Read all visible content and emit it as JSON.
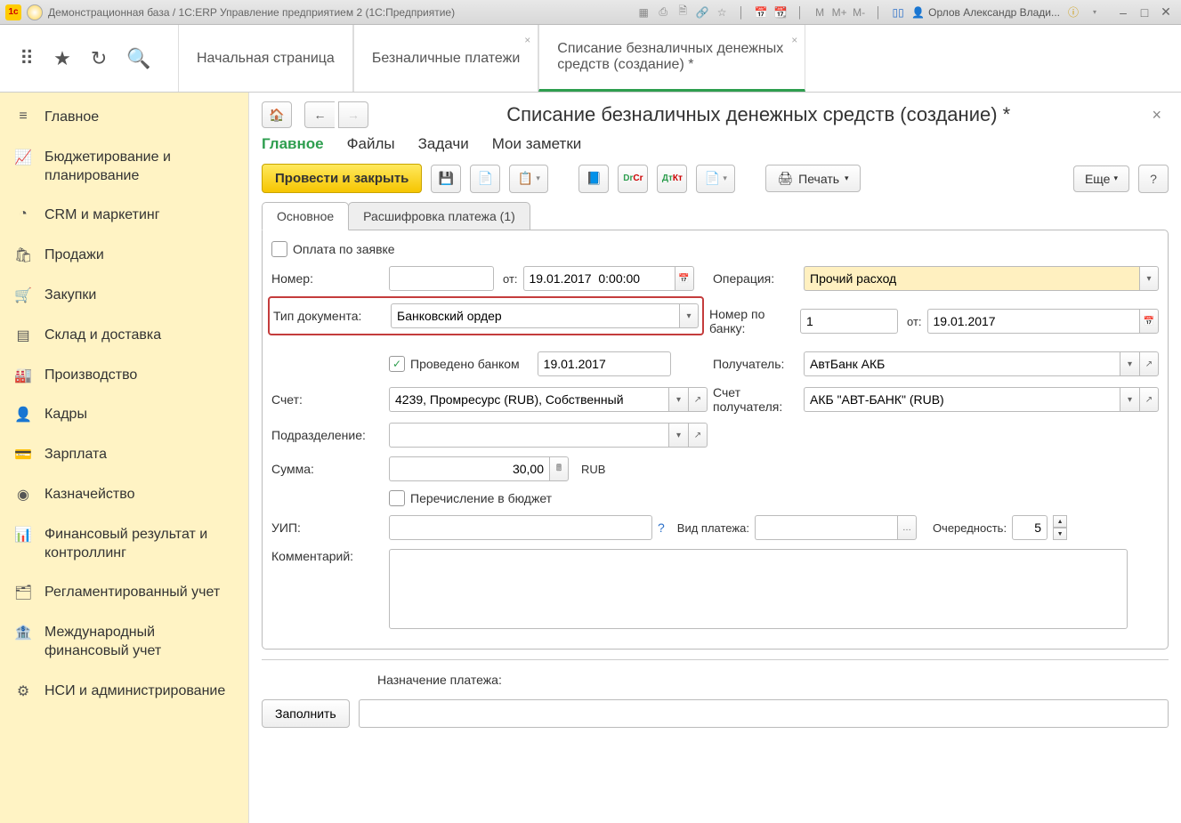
{
  "titlebar": {
    "title": "Демонстрационная база / 1С:ERP Управление предприятием 2  (1С:Предприятие)",
    "user": "Орлов Александр Влади..."
  },
  "top_tabs": {
    "tab0": "Начальная страница",
    "tab1": "Безналичные платежи",
    "tab2": "Списание безналичных денежных средств (создание) *"
  },
  "sidebar": [
    {
      "icon": "≡",
      "label": "Главное"
    },
    {
      "icon": "📈",
      "label": "Бюджетирование и планирование"
    },
    {
      "icon": "◔",
      "label": "CRM и маркетинг"
    },
    {
      "icon": "🛍",
      "label": "Продажи"
    },
    {
      "icon": "🛒",
      "label": "Закупки"
    },
    {
      "icon": "▤",
      "label": "Склад и доставка"
    },
    {
      "icon": "🏭",
      "label": "Производство"
    },
    {
      "icon": "👤",
      "label": "Кадры"
    },
    {
      "icon": "💳",
      "label": "Зарплата"
    },
    {
      "icon": "◉",
      "label": "Казначейство"
    },
    {
      "icon": "📊",
      "label": "Финансовый результат и контроллинг"
    },
    {
      "icon": "🗂",
      "label": "Регламентированный учет"
    },
    {
      "icon": "🏦",
      "label": "Международный финансовый учет"
    },
    {
      "icon": "⚙",
      "label": "НСИ и администрирование"
    }
  ],
  "page": {
    "title": "Списание безналичных денежных средств (создание) *",
    "section_tabs": {
      "main": "Главное",
      "files": "Файлы",
      "tasks": "Задачи",
      "notes": "Мои заметки"
    },
    "btn_post_close": "Провести и закрыть",
    "btn_print": "Печать",
    "btn_more": "Еще",
    "content_tabs": {
      "tab0": "Основное",
      "tab1": "Расшифровка платежа (1)"
    }
  },
  "form": {
    "pay_by_request_lbl": "Оплата по заявке",
    "number_lbl": "Номер:",
    "number_val": "",
    "from_lbl": "от:",
    "from_val": "19.01.2017  0:00:00",
    "operation_lbl": "Операция:",
    "operation_val": "Прочий расход",
    "doctype_lbl": "Тип документа:",
    "doctype_val": "Банковский ордер",
    "bank_num_lbl": "Номер по банку:",
    "bank_num_val": "1",
    "bank_from_lbl": "от:",
    "bank_from_val": "19.01.2017",
    "bank_processed_lbl": "Проведено банком",
    "bank_processed_date": "19.01.2017",
    "recipient_lbl": "Получатель:",
    "recipient_val": "АвтБанк АКБ",
    "account_lbl": "Счет:",
    "account_val": "4239, Промресурс (RUB), Собственный",
    "recipient_acc_lbl": "Счет получателя:",
    "recipient_acc_val": "АКБ \"АВТ-БАНК\" (RUB)",
    "division_lbl": "Подразделение:",
    "division_val": "",
    "sum_lbl": "Сумма:",
    "sum_val": "30,00",
    "currency": "RUB",
    "to_budget_lbl": "Перечисление в бюджет",
    "uip_lbl": "УИП:",
    "uip_val": "",
    "pay_kind_lbl": "Вид платежа:",
    "pay_kind_val": "",
    "priority_lbl": "Очередность:",
    "priority_val": "5",
    "comment_lbl": "Комментарий:",
    "comment_val": ""
  },
  "bottom": {
    "purpose_lbl": "Назначение платежа:",
    "purpose_val": "",
    "fill_btn": "Заполнить"
  }
}
